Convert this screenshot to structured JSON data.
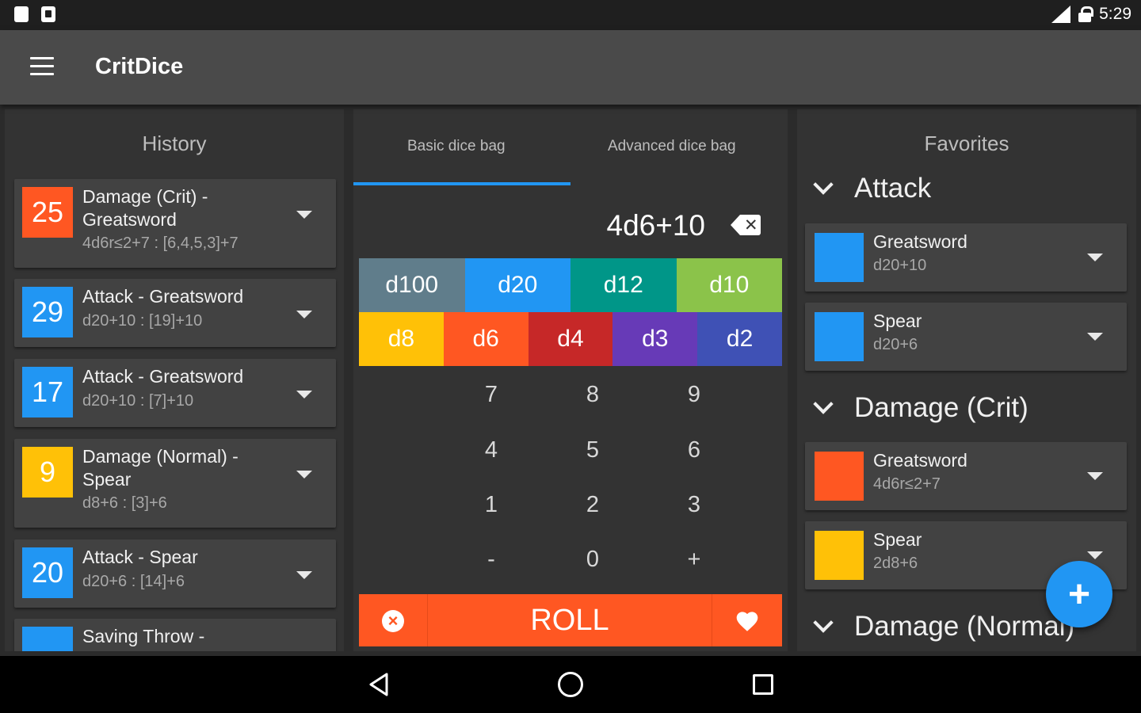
{
  "status_bar": {
    "time": "5:29"
  },
  "app_bar": {
    "title": "CritDice"
  },
  "history": {
    "header": "History",
    "items": [
      {
        "value": "25",
        "color": "#ff5722",
        "title": "Damage (Crit) - Greatsword",
        "formula": "4d6r≤2+7 : [6,4,5,3]+7"
      },
      {
        "value": "29",
        "color": "#2196f3",
        "title": "Attack - Greatsword",
        "formula": "d20+10 : [19]+10"
      },
      {
        "value": "17",
        "color": "#2196f3",
        "title": "Attack - Greatsword",
        "formula": "d20+10 : [7]+10"
      },
      {
        "value": "9",
        "color": "#ffc107",
        "title": "Damage (Normal) - Spear",
        "formula": "d8+6 : [3]+6"
      },
      {
        "value": "20",
        "color": "#2196f3",
        "title": "Attack - Spear",
        "formula": "d20+6 : [14]+6"
      },
      {
        "value": "",
        "color": "#2196f3",
        "title": "Saving Throw -",
        "formula": ""
      }
    ]
  },
  "dice_bag": {
    "tabs": [
      "Basic dice bag",
      "Advanced dice bag"
    ],
    "active_tab": 0,
    "expression": "4d6+10",
    "dice_row1": [
      {
        "label": "d100",
        "color": "#607d8b"
      },
      {
        "label": "d20",
        "color": "#2196f3"
      },
      {
        "label": "d12",
        "color": "#009688"
      },
      {
        "label": "d10",
        "color": "#8bc34a"
      }
    ],
    "dice_row2": [
      {
        "label": "d8",
        "color": "#ffc107"
      },
      {
        "label": "d6",
        "color": "#ff5722"
      },
      {
        "label": "d4",
        "color": "#c62828"
      },
      {
        "label": "d3",
        "color": "#673ab7"
      },
      {
        "label": "d2",
        "color": "#3f51b5"
      }
    ],
    "keypad": [
      "7",
      "8",
      "9",
      "4",
      "5",
      "6",
      "1",
      "2",
      "3",
      "-",
      "0",
      "+"
    ],
    "roll_label": "ROLL"
  },
  "favorites": {
    "header": "Favorites",
    "groups": [
      {
        "name": "Attack",
        "items": [
          {
            "name": "Greatsword",
            "formula": "d20+10",
            "color": "#2196f3"
          },
          {
            "name": "Spear",
            "formula": "d20+6",
            "color": "#2196f3"
          }
        ]
      },
      {
        "name": "Damage (Crit)",
        "items": [
          {
            "name": "Greatsword",
            "formula": "4d6r≤2+7",
            "color": "#ff5722"
          },
          {
            "name": "Spear",
            "formula": "2d8+6",
            "color": "#ffc107"
          }
        ]
      },
      {
        "name": "Damage (Normal)",
        "items": []
      }
    ]
  },
  "fab": {
    "label": "+"
  }
}
